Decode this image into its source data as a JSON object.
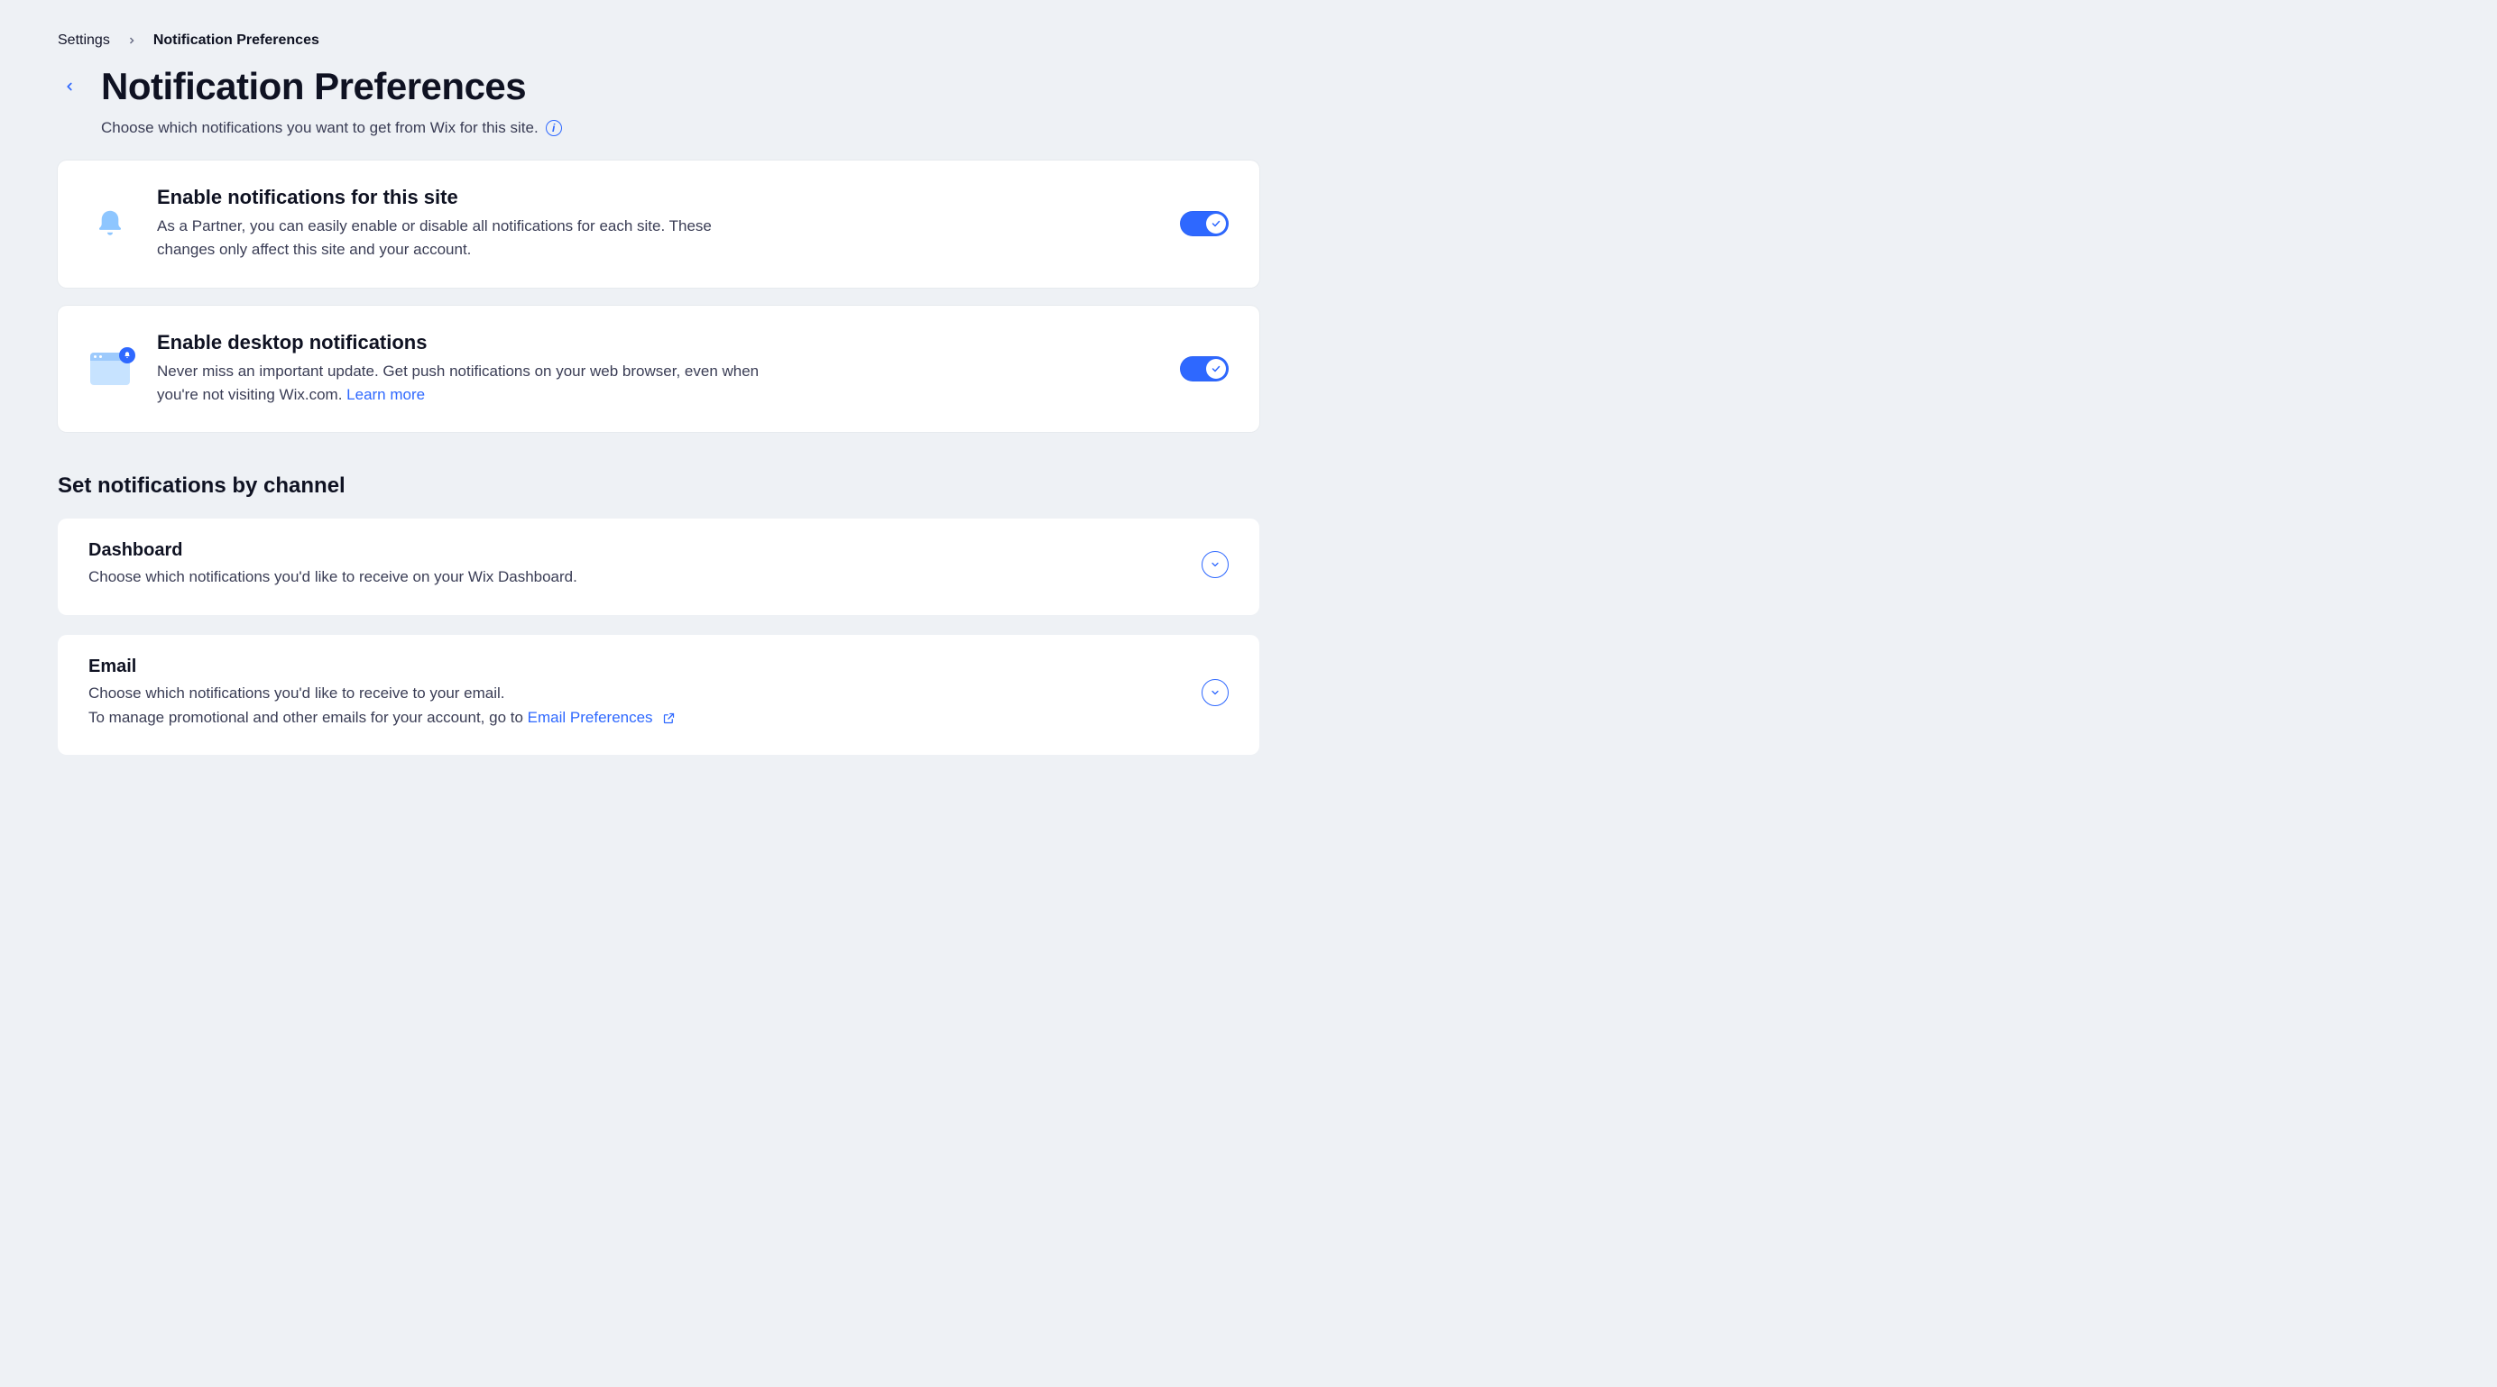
{
  "breadcrumb": {
    "root": "Settings",
    "current": "Notification Preferences"
  },
  "header": {
    "title": "Notification Preferences",
    "subtitle": "Choose which notifications you want to get from Wix for this site."
  },
  "cards": {
    "site_notifications": {
      "title": "Enable notifications for this site",
      "desc": "As a Partner, you can easily enable or disable all notifications for each site. These changes only affect this site and your account.",
      "enabled": true
    },
    "desktop_notifications": {
      "title": "Enable desktop notifications",
      "desc_prefix": "Never miss an important update. Get push notifications on your web browser, even when you're not visiting Wix.com. ",
      "learn_more": "Learn more",
      "enabled": true
    }
  },
  "section_heading": "Set notifications by channel",
  "channels": {
    "dashboard": {
      "title": "Dashboard",
      "desc": "Choose which notifications you'd like to receive on your Wix Dashboard."
    },
    "email": {
      "title": "Email",
      "desc_line1": "Choose which notifications you'd like to receive to your email.",
      "desc_line2_prefix": "To manage promotional and other emails for your account, go to ",
      "email_prefs_link": "Email Preferences"
    }
  }
}
